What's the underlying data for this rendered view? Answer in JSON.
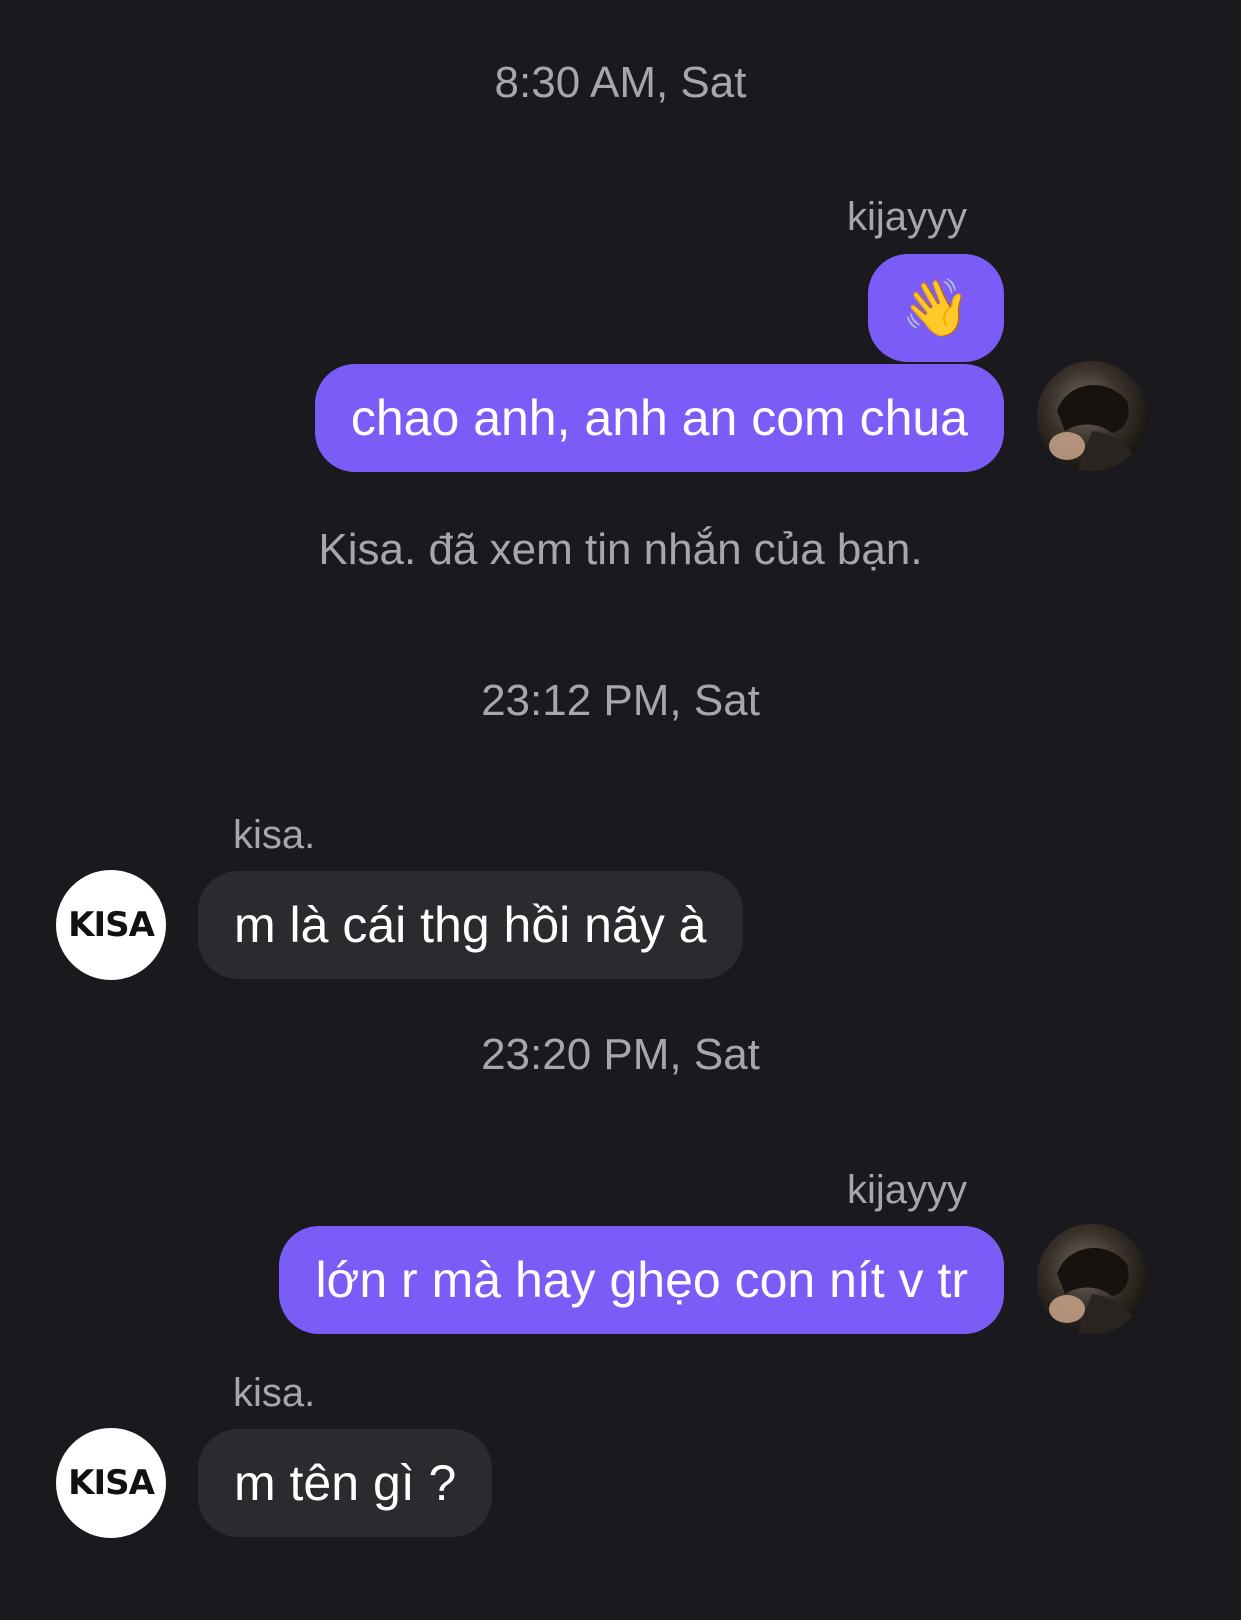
{
  "chat": {
    "timestamps": [
      "8:30 AM, Sat",
      "23:12 PM, Sat",
      "23:20 PM, Sat"
    ],
    "seen_notice": "Kisa. đã xem tin nhắn của bạn.",
    "me": {
      "name": "kijayyy"
    },
    "other": {
      "name": "kisa.",
      "avatar_text": "KISA"
    },
    "messages": [
      {
        "from": "me",
        "emoji": "👋"
      },
      {
        "from": "me",
        "text": "chao anh, anh an com chua"
      },
      {
        "from": "other",
        "text": "m là cái thg hồi nãy à"
      },
      {
        "from": "me",
        "text": "lớn r mà hay ghẹo con nít v tr"
      },
      {
        "from": "other",
        "text": "m tên gì ?"
      }
    ]
  },
  "colors": {
    "background": "#1a1a1e",
    "outgoing_bubble": "#7b5cf7",
    "incoming_bubble": "#2b2b2f",
    "meta_text": "#a7a7ab"
  }
}
